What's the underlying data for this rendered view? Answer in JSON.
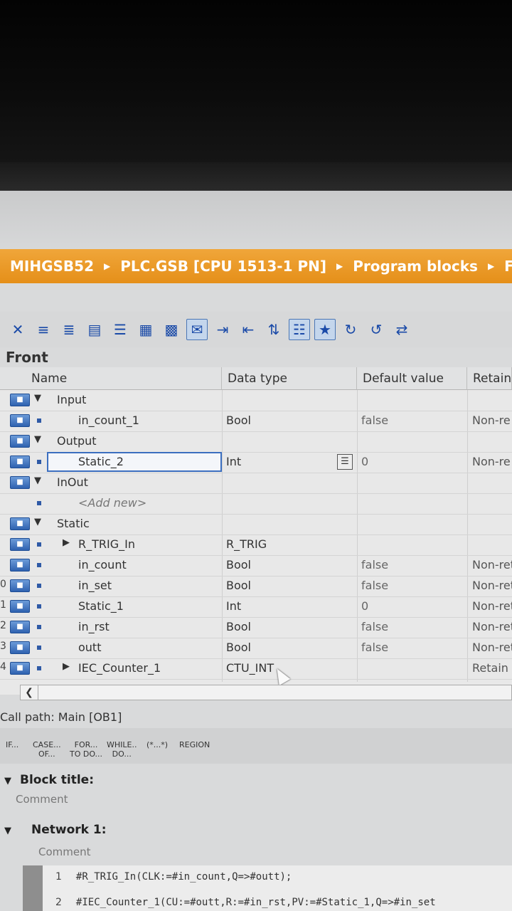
{
  "breadcrumb": {
    "items": [
      "MIHGSB52",
      "PLC.GSB [CPU 1513-1 PN]",
      "Program blocks",
      "Front"
    ]
  },
  "block_name": "Front",
  "columns": {
    "name": "Name",
    "data_type": "Data type",
    "default_value": "Default value",
    "retain": "Retain"
  },
  "rows": [
    {
      "num": "",
      "section": true,
      "name": "Input",
      "data_type": "",
      "default": "",
      "retain": ""
    },
    {
      "num": "",
      "section": false,
      "name": "in_count_1",
      "data_type": "Bool",
      "default": "false",
      "retain": "Non-re"
    },
    {
      "num": "",
      "section": true,
      "name": "Output",
      "data_type": "",
      "default": "",
      "retain": ""
    },
    {
      "num": "",
      "section": false,
      "name": "Static_2",
      "data_type": "Int",
      "default": "0",
      "retain": "Non-re"
    },
    {
      "num": "",
      "section": true,
      "name": "InOut",
      "data_type": "",
      "default": "",
      "retain": ""
    },
    {
      "num": "",
      "section": false,
      "name": "<Add new>",
      "data_type": "",
      "default": "",
      "retain": ""
    },
    {
      "num": "",
      "section": true,
      "name": "Static",
      "data_type": "",
      "default": "",
      "retain": ""
    },
    {
      "num": "",
      "section": false,
      "name": "R_TRIG_In",
      "data_type": "R_TRIG",
      "default": "",
      "retain": ""
    },
    {
      "num": "",
      "section": false,
      "name": "in_count",
      "data_type": "Bool",
      "default": "false",
      "retain": "Non-ret"
    },
    {
      "num": "0",
      "section": false,
      "name": "in_set",
      "data_type": "Bool",
      "default": "false",
      "retain": "Non-ret"
    },
    {
      "num": "1",
      "section": false,
      "name": "Static_1",
      "data_type": "Int",
      "default": "0",
      "retain": "Non-ret"
    },
    {
      "num": "2",
      "section": false,
      "name": "in_rst",
      "data_type": "Bool",
      "default": "false",
      "retain": "Non-reta"
    },
    {
      "num": "3",
      "section": false,
      "name": "outt",
      "data_type": "Bool",
      "default": "false",
      "retain": "Non-reta"
    },
    {
      "num": "4",
      "section": false,
      "name": "IEC_Counter_1",
      "data_type": "CTU_INT",
      "default": "",
      "retain": "Retain"
    }
  ],
  "call_path": "Call path: Main [OB1]",
  "snippets": [
    {
      "line1": "IF...",
      "line2": ""
    },
    {
      "line1": "CASE...",
      "line2": "OF..."
    },
    {
      "line1": "FOR...",
      "line2": "TO DO..."
    },
    {
      "line1": "WHILE..",
      "line2": "DO..."
    },
    {
      "line1": "(*...*)",
      "line2": ""
    },
    {
      "line1": "REGION",
      "line2": ""
    }
  ],
  "block_title": {
    "label": "Block title:",
    "comment": "Comment"
  },
  "network": {
    "label": "Network 1:",
    "comment": "Comment"
  },
  "code": [
    {
      "ln": "1",
      "text": "#R_TRIG_In(CLK:=#in_count,Q=>#outt);"
    },
    {
      "ln": "2",
      "text": "#IEC_Counter_1(CU:=#outt,R:=#in_rst,PV:=#Static_1,Q=>#in_set"
    }
  ]
}
